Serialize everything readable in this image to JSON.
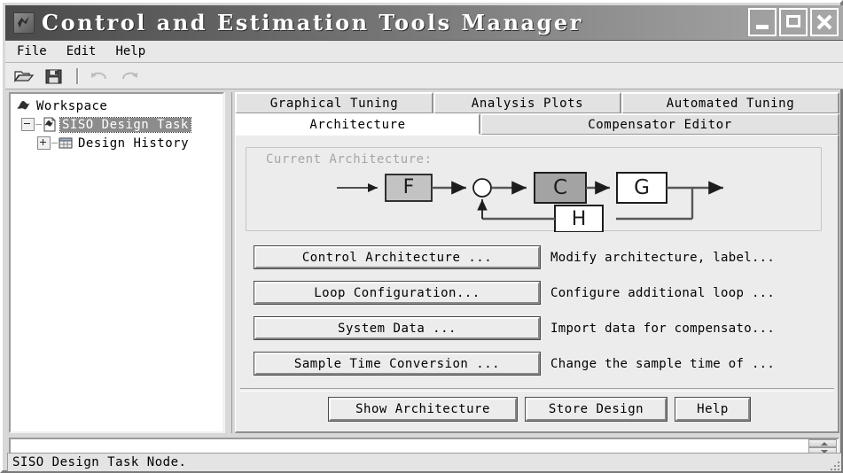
{
  "window": {
    "title": "Control and Estimation Tools Manager",
    "app_icon": "matlab-membrane-icon",
    "controls": {
      "minimize": "minimize-button",
      "maximize": "maximize-button",
      "close": "close-button"
    }
  },
  "menubar": {
    "items": [
      {
        "label": "File"
      },
      {
        "label": "Edit"
      },
      {
        "label": "Help"
      }
    ]
  },
  "toolbar": {
    "items": [
      {
        "name": "open-icon",
        "enabled": true
      },
      {
        "name": "save-icon",
        "enabled": true
      },
      {
        "name": "undo-icon",
        "enabled": false
      },
      {
        "name": "redo-icon",
        "enabled": false
      }
    ]
  },
  "tree": {
    "nodes": [
      {
        "label": "Workspace",
        "icon": "matlab-membrane-icon",
        "expander": "none",
        "selected": false,
        "indent": 0
      },
      {
        "label": "SISO Design Task",
        "icon": "siso-design-task-icon",
        "expander": "minus",
        "selected": true,
        "indent": 1
      },
      {
        "label": "Design History",
        "icon": "design-history-icon",
        "expander": "plus",
        "selected": false,
        "indent": 2
      }
    ]
  },
  "tabs": {
    "row1": [
      {
        "label": "Graphical Tuning",
        "active": false
      },
      {
        "label": "Analysis Plots",
        "active": false
      },
      {
        "label": "Automated Tuning",
        "active": false
      }
    ],
    "row2": [
      {
        "label": "Architecture",
        "active": true
      },
      {
        "label": "Compensator Editor",
        "active": false
      }
    ]
  },
  "architecture": {
    "group_label": "Current Architecture:",
    "blocks": [
      {
        "label": "F",
        "fill": "#c3c3c3"
      },
      {
        "label": "C",
        "fill": "#a3a3a3"
      },
      {
        "label": "G",
        "fill": "#ffffff"
      },
      {
        "label": "H",
        "fill": "#ffffff"
      }
    ],
    "summing_junction": "sum-junction-circle"
  },
  "actions": [
    {
      "button": "Control Architecture ...",
      "description": "Modify architecture, label..."
    },
    {
      "button": "Loop Configuration...",
      "description": "Configure additional loop ..."
    },
    {
      "button": "System Data ...",
      "description": "Import data for compensato..."
    },
    {
      "button": "Sample Time Conversion ...",
      "description": "Change the sample time of ..."
    }
  ],
  "bottom_buttons": [
    {
      "label": "Show Architecture"
    },
    {
      "label": "Store Design"
    },
    {
      "label": "Help"
    }
  ],
  "bottom_list": {
    "value": "",
    "scroll_up": "scroll-up-arrow",
    "scroll_down": "scroll-down-arrow"
  },
  "statusbar": {
    "text": "SISO Design Task Node."
  },
  "colors": {
    "titlebar_left": "#4a4a4a",
    "titlebar_right": "#a8a8a8",
    "selection": "#8c8c8c",
    "panel": "#ececec",
    "window_bg": "#d8d8d8"
  }
}
